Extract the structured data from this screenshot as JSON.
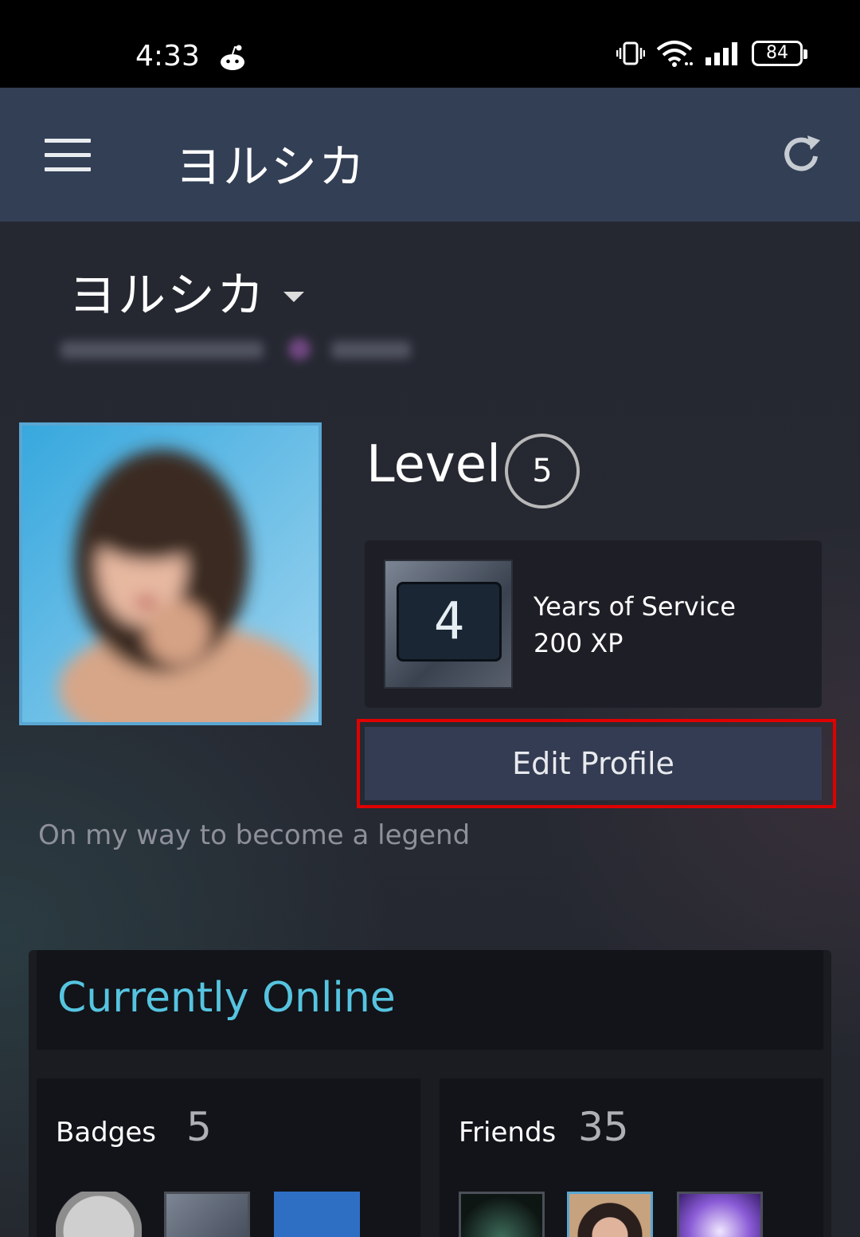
{
  "status_bar": {
    "time": "4:33",
    "battery": "84",
    "icons": [
      "reddit-notification-icon",
      "vibrate-icon",
      "wifi-icon",
      "signal-icon",
      "battery-icon"
    ]
  },
  "app_bar": {
    "title": "ヨルシカ",
    "menu_icon": "hamburger-menu-icon",
    "refresh_icon": "refresh-icon"
  },
  "profile": {
    "name": "ヨルシカ",
    "level_label": "Level",
    "level": "5",
    "badge": {
      "number": "4",
      "title": "Years of Service",
      "xp": "200 XP"
    },
    "edit_button": "Edit Profile",
    "summary": "On my way to become a legend"
  },
  "showcase": {
    "status": "Currently Online",
    "badges_label": "Badges",
    "badges_count": "5",
    "friends_label": "Friends",
    "friends_count": "35"
  },
  "colors": {
    "accent_online": "#56c4e0",
    "app_bar": "#333f55",
    "highlight": "#e00000"
  }
}
